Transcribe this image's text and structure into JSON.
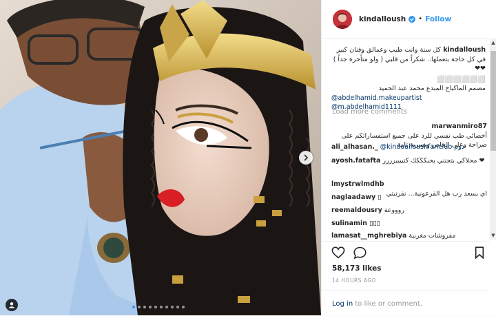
{
  "header": {
    "username": "kindalloush",
    "separator": "•",
    "follow_label": "Follow"
  },
  "caption": {
    "user": "kindalloush",
    "text": "كل سنة وانت طيب وعمالق وفنان كبير في كل حاجة بتعملها.. شكراً من قلبي ( ولو متأخرة جداً ) ❤❤",
    "line2": "مصمم الماكياج المبدع محمد عبد الحميد",
    "mention1": "@abdelhamid.makeupartist",
    "mention2": "@m.abdelhamid1111"
  },
  "load_more": "Load more comments",
  "comments": [
    {
      "user": "marwanmiro87",
      "text": "أخصائي طب نفسي للرد على جميع استفساراتكم على صراحة وعلى الخاص وبسرية تامة"
    },
    {
      "user": "ali_alhasan._",
      "text": "@kindaalloushfanclub دوم"
    },
    {
      "user": "ayosh.fatafta",
      "text": "محلاكي بتجنني بحبكككك كتييييرررر ❤"
    },
    {
      "user": "lmystrwlmdhb",
      "text": "اي يسعد رب هل الفرعونية... نفرتيتي"
    },
    {
      "user": "naglaadawy",
      "text": "▯"
    },
    {
      "user": "reemaldousry",
      "text": "روووعة"
    },
    {
      "user": "sulinamin",
      "text": "▯▯▯"
    },
    {
      "user": "lamasat__mghrebiya",
      "text": "مفروشات مغربية"
    }
  ],
  "likes": "58,173 likes",
  "timestamp": "14 HOURS AGO",
  "footer": {
    "login_link": "Log in",
    "login_rest": " to like or comment."
  },
  "carousel": {
    "total": 10,
    "active": 0
  },
  "colors": {
    "accent": "#3897f0",
    "mention": "#003569",
    "muted": "#999999"
  },
  "icons": [
    "heart-icon",
    "comment-icon",
    "bookmark-icon",
    "chevron-right-icon",
    "user-tag-icon",
    "verified-badge-icon"
  ]
}
